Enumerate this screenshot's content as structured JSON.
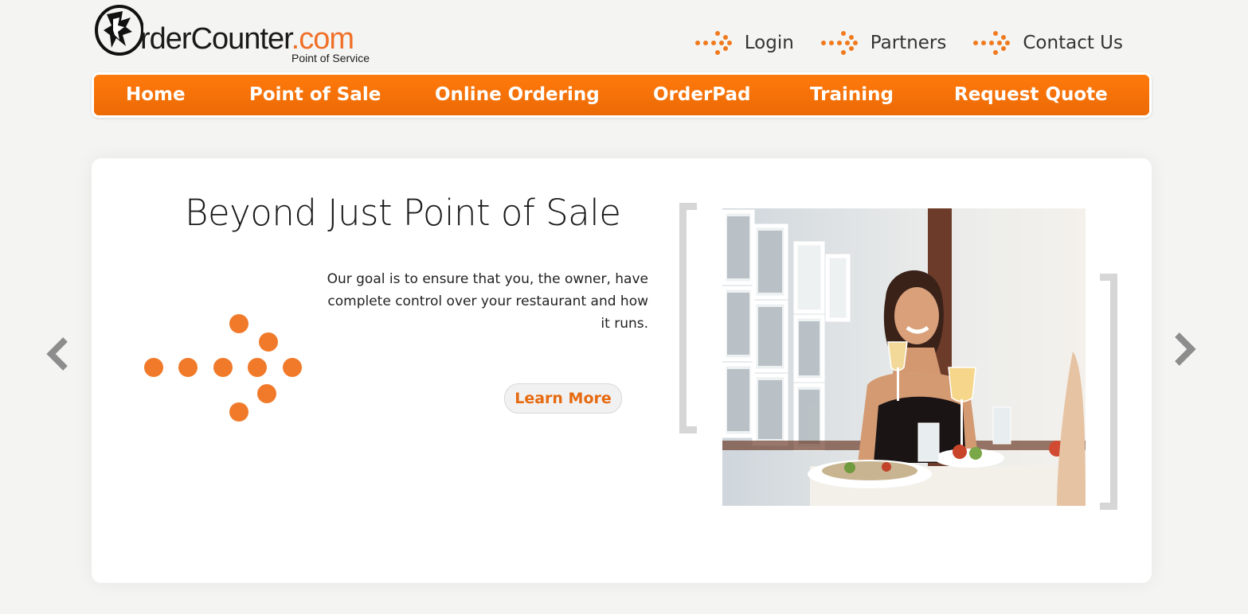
{
  "brand": {
    "name_main": "rderCounter",
    "name_domain": ".com",
    "tagline": "Point of Service"
  },
  "toplinks": [
    {
      "label": "Login",
      "icon": "dot-arrow-icon"
    },
    {
      "label": "Partners",
      "icon": "dot-arrow-icon"
    },
    {
      "label": "Contact Us",
      "icon": "dot-arrow-icon"
    }
  ],
  "nav": [
    {
      "label": "Home"
    },
    {
      "label": "Point of Sale"
    },
    {
      "label": "Online Ordering"
    },
    {
      "label": "OrderPad"
    },
    {
      "label": "Training"
    },
    {
      "label": "Request Quote"
    }
  ],
  "slide": {
    "headline": "Beyond Just Point of Sale",
    "body": "Our goal is to ensure that you, the owner, have complete control over your restaurant and how it runs.",
    "cta": "Learn More",
    "image": "woman-dining-photo"
  },
  "carousel": {
    "prev_icon": "chevron-left-icon",
    "next_icon": "chevron-right-icon"
  },
  "colors": {
    "accent": "#f07a1e",
    "nav_bg": "#ff7306",
    "bracket": "#d6d6d6",
    "page_bg": "#f4f4f3"
  }
}
